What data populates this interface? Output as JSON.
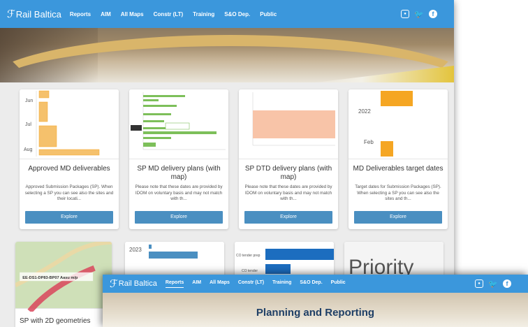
{
  "screen1": {
    "nav": {
      "logo": "Rail Baltica",
      "items": [
        "Reports",
        "AIM",
        "All Maps",
        "Constr (LT)",
        "Training",
        "S&O Dep.",
        "Public"
      ],
      "socials": [
        "instagram-icon",
        "twitter-icon",
        "facebook-icon"
      ]
    },
    "cards": [
      {
        "title": "Approved MD deliverables",
        "desc": "Approved Submission Packages (SP). When selecting a SP you can see also the sites and their locati...",
        "button": "Explore",
        "thumb_labels": [
          "Jun",
          "Jul",
          "Aug"
        ]
      },
      {
        "title": "SP MD delivery plans (with map)",
        "desc": "Please note that these dates are provided by IDOM on voluntary basis and may not match with th...",
        "button": "Explore"
      },
      {
        "title": "SP DTD delivery plans (with map)",
        "desc": "Please note that these dates are provided by IDOM on voluntary basis and may not match with th...",
        "button": "Explore"
      },
      {
        "title": "MD Deliverables target dates",
        "desc": "Target dates for Submission Packages (SP). When selecting a SP you can see also the sites and th...",
        "button": "Explore",
        "thumb_labels": [
          "2022",
          "Feb"
        ]
      }
    ],
    "row2": [
      {
        "title": "SP with 2D geometries",
        "map_label": "EE-DS1-DP83-BP07 Aasu m/p"
      },
      {
        "thumb_label": "2023"
      },
      {
        "thumb_labels": [
          "CO tender prep",
          "CO tender"
        ]
      },
      {
        "thumb_text": "Priority"
      }
    ]
  },
  "screen2": {
    "nav": {
      "logo": "Rail Baltica",
      "items": [
        "Reports",
        "AIM",
        "All Maps",
        "Constr (LT)",
        "Training",
        "S&O Dep.",
        "Public"
      ],
      "active": "Reports",
      "socials": [
        "instagram-icon",
        "twitter-icon",
        "facebook-icon"
      ]
    },
    "title": "Planning and Reporting"
  },
  "colors": {
    "nav_blue": "#3b97dc",
    "button_blue": "#4a8fc1",
    "bar_orange": "#f5a623",
    "bar_green": "#7dbf5a",
    "band_salmon": "#f8c4a8"
  }
}
